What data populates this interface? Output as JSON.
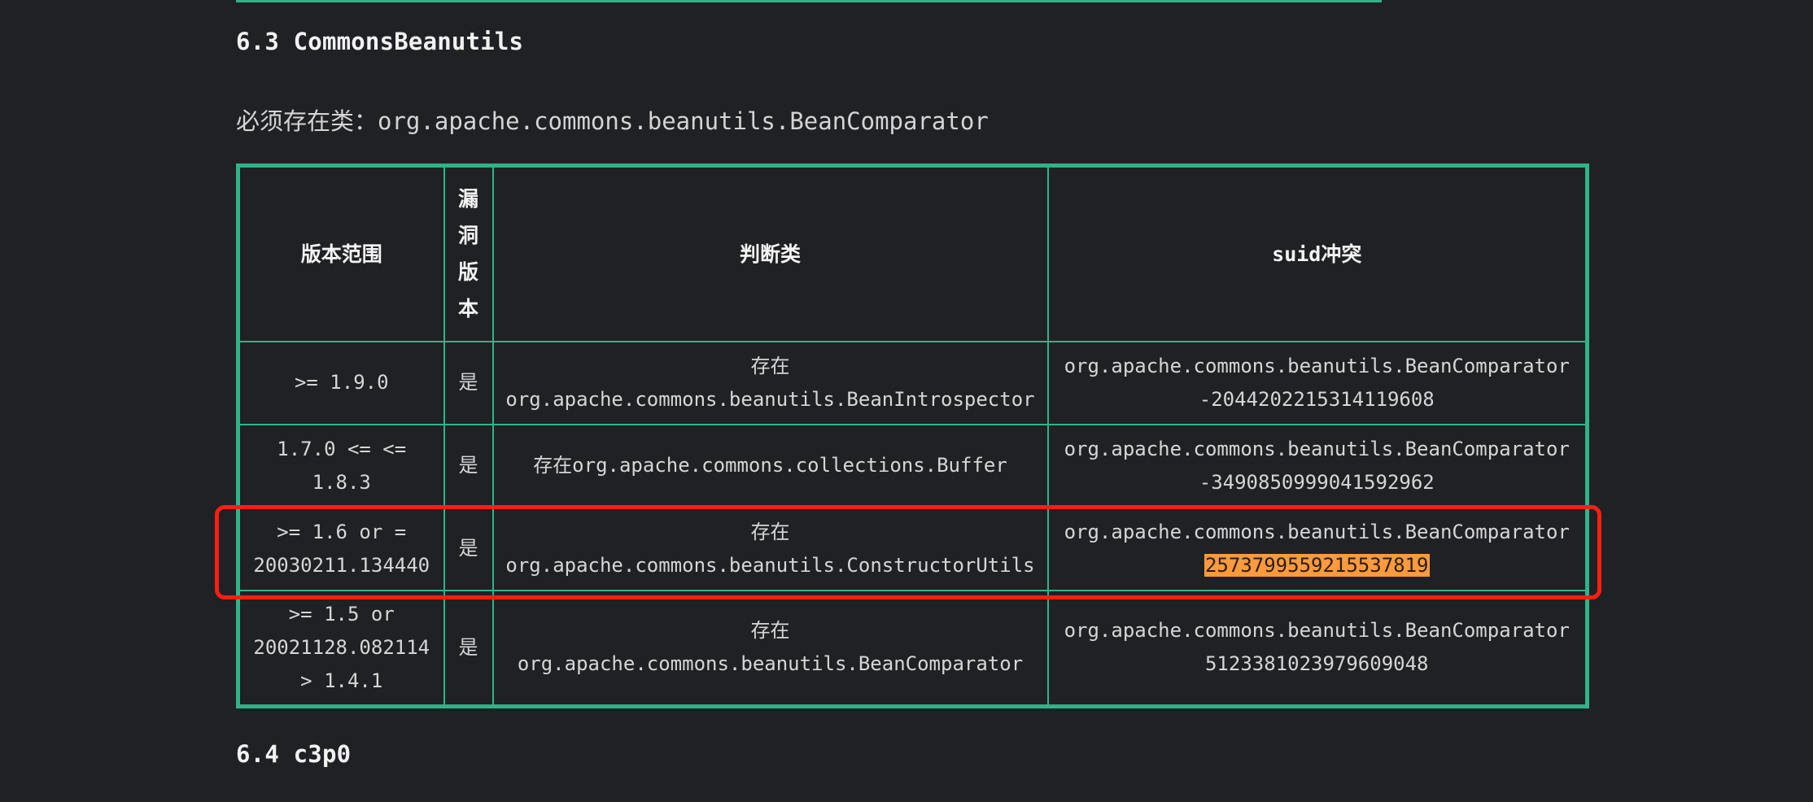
{
  "section_63": {
    "title": "6.3 CommonsBeanutils",
    "required_prefix": "必须存在类：",
    "required_class": "org.apache.commons.beanutils.BeanComparator"
  },
  "table": {
    "headers": {
      "version_range": "版本范围",
      "vulnerable_version": "漏洞版本",
      "detect_class": "判断类",
      "suid_conflict": "suid冲突"
    },
    "rows": [
      {
        "version_lines": [
          ">= 1.9.0"
        ],
        "vulnerable": "是",
        "detect_lines": [
          "存在",
          "org.apache.commons.beanutils.BeanIntrospector"
        ],
        "suid_class": "org.apache.commons.beanutils.BeanComparator",
        "suid_value": "-2044202215314119608"
      },
      {
        "version_lines": [
          "1.7.0 <= <=",
          "1.8.3"
        ],
        "vulnerable": "是",
        "detect_lines": [
          "存在org.apache.commons.collections.Buffer"
        ],
        "suid_class": "org.apache.commons.beanutils.BeanComparator",
        "suid_value": "-3490850999041592962"
      },
      {
        "version_lines": [
          ">= 1.6 or =",
          "20030211.134440"
        ],
        "vulnerable": "是",
        "detect_lines": [
          "存在",
          "org.apache.commons.beanutils.ConstructorUtils"
        ],
        "suid_class": "org.apache.commons.beanutils.BeanComparator",
        "suid_value": "2573799559215537819"
      },
      {
        "version_lines": [
          ">= 1.5 or",
          "20021128.082114",
          "> 1.4.1"
        ],
        "vulnerable": "是",
        "detect_lines": [
          "存在",
          "org.apache.commons.beanutils.BeanComparator"
        ],
        "suid_class": "org.apache.commons.beanutils.BeanComparator",
        "suid_value": "5123381023979609048"
      }
    ]
  },
  "section_64": {
    "title": "6.4 c3p0"
  },
  "colors": {
    "background": "#202124",
    "table_border": "#2fb487",
    "highlight": "#ff9a3d",
    "annotation_box": "#ff1f12"
  }
}
